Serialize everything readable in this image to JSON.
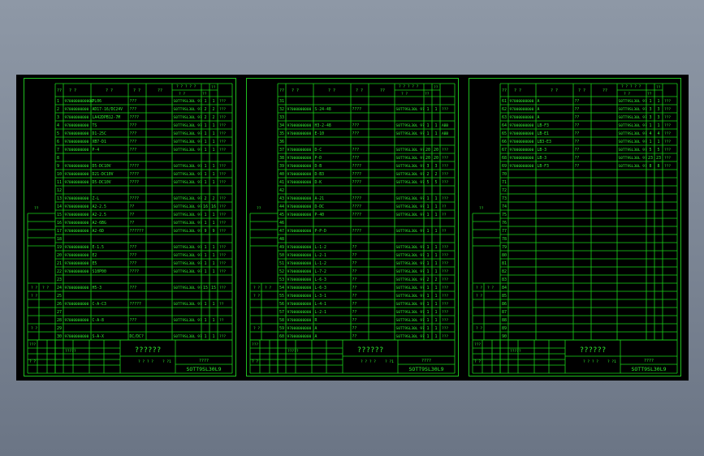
{
  "colors": {
    "line": "#18d418",
    "text": "#2ff02f",
    "background": "#000000",
    "workspace": "#8e98a6"
  },
  "header": {
    "c1": "??",
    "c2": "? ?",
    "c3": "? ?",
    "c4": "? ?",
    "c5": "??",
    "top_group": "? ? ? ? ?",
    "sub1": "? ?",
    "sub2": "??",
    "sub3": "??"
  },
  "titleblock": {
    "title": "??????",
    "subtitle": "????",
    "drawing_no": "SOTT9SL30L9",
    "row1": "???",
    "row2": "? ?",
    "row3": "?????",
    "sub_a": "? ? ? ?",
    "sub_b": "? ?1"
  },
  "side_labels": [
    "? ?",
    "? ?",
    "? ?",
    "? ?",
    "??"
  ],
  "sheets": [
    {
      "rows": [
        [
          "1",
          "9700000000000",
          "PL06",
          "???",
          "S0TT9SL30L 9?",
          "1",
          "1",
          "???"
        ],
        [
          "2",
          "97000000000",
          "AD17-16/DC24V",
          "???",
          "S0TT9SL30L 9?",
          "2",
          "2",
          "???"
        ],
        [
          "3",
          "97000000000",
          "LA42DPB12-7M",
          "????",
          "S0TT9SL30L 9?",
          "2",
          "2",
          "???"
        ],
        [
          "4",
          "97000000000",
          "TS",
          "???",
          "S0TT9SL30L 9?",
          "1",
          "1",
          "???"
        ],
        [
          "5",
          "97000000000",
          "D1-25C",
          "???",
          "S0TT9SL30L 9?",
          "1",
          "1",
          "???"
        ],
        [
          "6",
          "97000000000",
          "XB7-D1",
          "???",
          "S0TT9SL30L 9?",
          "1",
          "1",
          "???"
        ],
        [
          "7",
          "97000000000",
          "P-4",
          "???",
          "S0TT9SL30L 9?",
          "1",
          "1",
          "???"
        ],
        [
          "8",
          "",
          "",
          "",
          "",
          "",
          "",
          ""
        ],
        [
          "9",
          "97000000000",
          "D5-DC10V",
          "????",
          "S0TT9SL30L 9?",
          "1",
          "1",
          "???"
        ],
        [
          "10",
          "97000000000",
          "D21-DC10V",
          "????",
          "S0TT9SL30L 9?",
          "1",
          "1",
          "???"
        ],
        [
          "11",
          "97000000000",
          "D5-DC10V",
          "????",
          "S0TT9SL30L 9?",
          "1",
          "1",
          "???"
        ],
        [
          "12",
          "",
          "",
          "",
          "",
          "",
          "",
          ""
        ],
        [
          "13",
          "97000000000",
          "Z-L",
          "????",
          "S0TT9SL30L 9?",
          "2",
          "2",
          "???"
        ],
        [
          "14",
          "97000000000",
          "A2-2.5",
          "??",
          "S0TT9SL30L 9?",
          "16",
          "16",
          "???"
        ],
        [
          "15",
          "97000000000",
          "A2-2.5",
          "??",
          "S0TT9SL30L 9?",
          "1",
          "1",
          "???"
        ],
        [
          "16",
          "97000000000",
          "A2-6BG",
          "??",
          "S0TT9SL30L 9?",
          "1",
          "1",
          "???"
        ],
        [
          "17",
          "97000000000",
          "A2-6D",
          "??????",
          "S0TT9SL30L 9?",
          "9",
          "9",
          "???"
        ],
        [
          "18",
          "",
          "",
          "",
          "",
          "",
          "",
          ""
        ],
        [
          "19",
          "97000000000",
          "E-1.5",
          "???",
          "S0TT9SL30L 9?",
          "1",
          "1",
          "???"
        ],
        [
          "20",
          "97000000000",
          "E2",
          "???",
          "S0TT9SL30L 9?",
          "1",
          "1",
          "???"
        ],
        [
          "21",
          "97000000000",
          "E5",
          "???",
          "S0TT9SL30L 9?",
          "1",
          "1",
          "???"
        ],
        [
          "22",
          "97000000000",
          "S10P00",
          "????",
          "S0TT9SL30L 9?",
          "1",
          "1",
          "???"
        ],
        [
          "23",
          "",
          "",
          "",
          "",
          "",
          "",
          ""
        ],
        [
          "24",
          "97000000000",
          "H5-3",
          "???",
          "S0TT9SL30L 9?",
          "15",
          "15",
          "???"
        ],
        [
          "25",
          "",
          "",
          "",
          "",
          "",
          "",
          ""
        ],
        [
          "26",
          "97000000000",
          "C-A-C3",
          "?????",
          "S0TT9SL30L 9?",
          "1",
          "1",
          "??"
        ],
        [
          "27",
          "",
          "",
          "",
          "",
          "",
          "",
          ""
        ],
        [
          "28",
          "97000000000",
          "C-A-8",
          "???",
          "S0TT9SL30L 9?",
          "1",
          "1",
          "??"
        ],
        [
          "29",
          "",
          "",
          "",
          "",
          "",
          "",
          ""
        ],
        [
          "30",
          "97000000000",
          "S-A-X",
          "DC/DC?",
          "S0TT9SL30L 9?",
          "1",
          "1",
          "???"
        ]
      ]
    },
    {
      "rows": [
        [
          "31",
          "",
          "",
          "",
          "",
          "",
          "",
          ""
        ],
        [
          "32",
          "97000000000",
          "S-24-48",
          "????",
          "S0TT9SL30L 9?",
          "1",
          "1",
          "???"
        ],
        [
          "33",
          "",
          "",
          "",
          "",
          "",
          "",
          ""
        ],
        [
          "34",
          "97000000000",
          "H3-2-48",
          "???",
          "S0TT9SL30L 9?",
          "1",
          "1",
          "ABB"
        ],
        [
          "35",
          "97000000000",
          "E-10",
          "???",
          "S0TT9SL30L 9?",
          "1",
          "1",
          "ABB"
        ],
        [
          "36",
          "",
          "",
          "",
          "",
          "",
          "",
          ""
        ],
        [
          "37",
          "97000000000",
          "D-C",
          "???",
          "S0TT9SL30L 9?",
          "20",
          "20",
          "???"
        ],
        [
          "38",
          "97000000000",
          "P-D",
          "???",
          "S0TT9SL30L 9?",
          "20",
          "20",
          "???"
        ],
        [
          "39",
          "97000000000",
          "D-B",
          "????",
          "S0TT9SL30L 9?",
          "3",
          "3",
          "???"
        ],
        [
          "40",
          "97000000000",
          "D-B3",
          "????",
          "S0TT9SL30L 9?",
          "2",
          "2",
          "???"
        ],
        [
          "41",
          "97000000000",
          "D-K",
          "????",
          "S0TT9SL30L 9?",
          "5",
          "5",
          "???"
        ],
        [
          "42",
          "",
          "",
          "",
          "",
          "",
          "",
          ""
        ],
        [
          "43",
          "97000000000",
          "A-21",
          "????",
          "S0TT9SL30L 9?",
          "1",
          "1",
          "???"
        ],
        [
          "44",
          "97000000000",
          "D-DC",
          "????",
          "S0TT9SL30L 9?",
          "1",
          "1",
          "??"
        ],
        [
          "45",
          "97000000000",
          "P-40",
          "????",
          "S0TT9SL30L 9?",
          "1",
          "1",
          "??"
        ],
        [
          "46",
          "",
          "",
          "",
          "",
          "",
          "",
          ""
        ],
        [
          "47",
          "97000000000",
          "P-P-D",
          "????",
          "S0TT9SL30L 9?",
          "1",
          "1",
          "??"
        ],
        [
          "48",
          "",
          "",
          "",
          "",
          "",
          "",
          ""
        ],
        [
          "49",
          "97000000000",
          "L-1-2",
          "??",
          "S0TT9SL30L 9?",
          "1",
          "1",
          "???"
        ],
        [
          "50",
          "97000000000",
          "L-2-1",
          "??",
          "S0TT9SL30L 9?",
          "1",
          "1",
          "???"
        ],
        [
          "51",
          "97000000000",
          "L-1-2",
          "??",
          "S0TT9SL30L 9?",
          "1",
          "1",
          "???"
        ],
        [
          "52",
          "97000000000",
          "L-7-2",
          "??",
          "S0TT9SL30L 9?",
          "1",
          "1",
          "???"
        ],
        [
          "53",
          "97000000000",
          "L-6-3",
          "??",
          "S0TT9SL30L 9?",
          "2",
          "2",
          "???"
        ],
        [
          "54",
          "97000000000",
          "L-6-3",
          "??",
          "S0TT9SL30L 9?",
          "1",
          "1",
          "???"
        ],
        [
          "55",
          "97000000000",
          "L-3-1",
          "??",
          "S0TT9SL30L 9?",
          "1",
          "1",
          "???"
        ],
        [
          "56",
          "97000000000",
          "L-4-1",
          "??",
          "S0TT9SL30L 9?",
          "1",
          "1",
          "???"
        ],
        [
          "57",
          "97000000000",
          "L-2-1",
          "??",
          "S0TT9SL30L 9?",
          "1",
          "1",
          "???"
        ],
        [
          "58",
          "97000000000",
          "R",
          "??",
          "S0TT9SL30L 9?",
          "1",
          "1",
          "???"
        ],
        [
          "59",
          "97000000000",
          "A",
          "??",
          "S0TT9SL30L 9?",
          "1",
          "1",
          "???"
        ],
        [
          "60",
          "97000000000",
          "A",
          "??",
          "S0TT9SL30L 9?",
          "1",
          "1",
          "???"
        ]
      ]
    },
    {
      "rows": [
        [
          "61",
          "97000000000",
          "A",
          "??",
          "S0TT9SL30L 9?",
          "1",
          "1",
          "???"
        ],
        [
          "62",
          "97000000000",
          "A",
          "??",
          "S0TT9SL30L 9?",
          "3",
          "3",
          "???"
        ],
        [
          "63",
          "97000000000",
          "A",
          "??",
          "S0TT9SL30L 9?",
          "3",
          "3",
          "???"
        ],
        [
          "64",
          "97000000000",
          "LB-F3",
          "??",
          "S0TT9SL30L 9?",
          "1",
          "1",
          "???"
        ],
        [
          "65",
          "97000000000",
          "LB-E1",
          "??",
          "S0TT9SL30L 9?",
          "4",
          "4",
          "???"
        ],
        [
          "66",
          "97000000000",
          "LB3-E3",
          "??",
          "S0TT9SL30L 9?",
          "1",
          "1",
          "???"
        ],
        [
          "67",
          "97000000000",
          "LB-3",
          "??",
          "S0TT9SL30L 9?",
          "5",
          "5",
          "???"
        ],
        [
          "68",
          "97000000000",
          "LB-3",
          "??",
          "S0TT9SL30L 9?",
          "23",
          "23",
          "???"
        ],
        [
          "69",
          "97000000000",
          "LB-F3",
          "??",
          "S0TT9SL30L 9?",
          "8",
          "8",
          "???"
        ],
        [
          "70",
          "",
          "",
          "",
          "",
          "",
          "",
          ""
        ],
        [
          "71",
          "",
          "",
          "",
          "",
          "",
          "",
          ""
        ],
        [
          "72",
          "",
          "",
          "",
          "",
          "",
          "",
          ""
        ],
        [
          "73",
          "",
          "",
          "",
          "",
          "",
          "",
          ""
        ],
        [
          "74",
          "",
          "",
          "",
          "",
          "",
          "",
          ""
        ],
        [
          "75",
          "",
          "",
          "",
          "",
          "",
          "",
          ""
        ],
        [
          "76",
          "",
          "",
          "",
          "",
          "",
          "",
          ""
        ],
        [
          "77",
          "",
          "",
          "",
          "",
          "",
          "",
          ""
        ],
        [
          "78",
          "",
          "",
          "",
          "",
          "",
          "",
          ""
        ],
        [
          "79",
          "",
          "",
          "",
          "",
          "",
          "",
          ""
        ],
        [
          "80",
          "",
          "",
          "",
          "",
          "",
          "",
          ""
        ],
        [
          "81",
          "",
          "",
          "",
          "",
          "",
          "",
          ""
        ],
        [
          "82",
          "",
          "",
          "",
          "",
          "",
          "",
          ""
        ],
        [
          "83",
          "",
          "",
          "",
          "",
          "",
          "",
          ""
        ],
        [
          "84",
          "",
          "",
          "",
          "",
          "",
          "",
          ""
        ],
        [
          "85",
          "",
          "",
          "",
          "",
          "",
          "",
          ""
        ],
        [
          "86",
          "",
          "",
          "",
          "",
          "",
          "",
          ""
        ],
        [
          "87",
          "",
          "",
          "",
          "",
          "",
          "",
          ""
        ],
        [
          "88",
          "",
          "",
          "",
          "",
          "",
          "",
          ""
        ],
        [
          "89",
          "",
          "",
          "",
          "",
          "",
          "",
          ""
        ],
        [
          "90",
          "",
          "",
          "",
          "",
          "",
          "",
          ""
        ]
      ]
    }
  ]
}
